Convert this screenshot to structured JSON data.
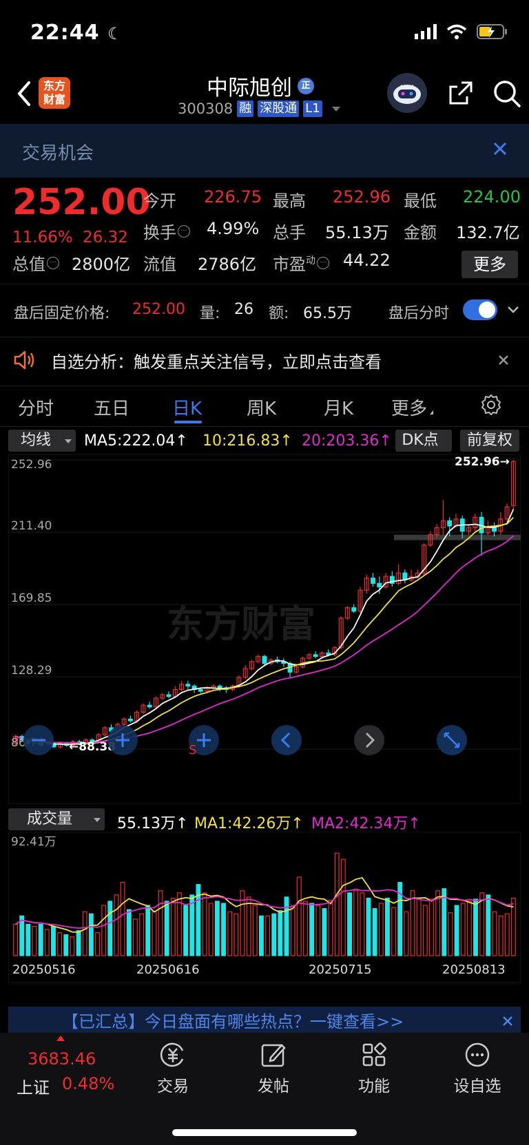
{
  "status": {
    "time": "22:44"
  },
  "nav": {
    "logo_line1": "东方",
    "logo_line2": "财富",
    "stock_name": "中际旭创",
    "name_badge": "正",
    "code": "300308",
    "tags": [
      "融",
      "深股通",
      "L1"
    ]
  },
  "opportunity": {
    "text": "交易机会"
  },
  "quote": {
    "price": "252.00",
    "pct": "11.66%",
    "change": "26.32",
    "open_label": "今开",
    "open": "226.75",
    "high_label": "最高",
    "high": "252.96",
    "low_label": "最低",
    "low": "224.00",
    "turnover_label": "换手",
    "turnover": "4.99%",
    "volume_label": "总手",
    "volume": "55.13万",
    "amount_label": "金额",
    "amount": "132.7亿",
    "mcap_label": "总值",
    "mcap": "2800亿",
    "float_label": "流值",
    "float": "2786亿",
    "pe_label": "市盈",
    "pe_sup": "动",
    "pe": "44.22",
    "more_label": "更多"
  },
  "after_hours": {
    "fixed_label": "盘后固定价格:",
    "fixed_price": "252.00",
    "vol_label": "量:",
    "vol": "26",
    "amt_label": "额:",
    "amt": "65.5万",
    "timeshare_label": "盘后分时"
  },
  "notice": {
    "text": "自选分析：触发重点关注信号，立即点击查看"
  },
  "tabs": [
    {
      "label": "分时"
    },
    {
      "label": "五日"
    },
    {
      "label": "日K"
    },
    {
      "label": "周K"
    },
    {
      "label": "月K"
    },
    {
      "label": "更多"
    }
  ],
  "active_tab": "日K",
  "ma_row": {
    "selector": "均线",
    "ma5": "MA5:222.04↑",
    "ma10": "10:216.83↑",
    "ma20": "20:203.36↑",
    "dk": "DK点",
    "adjust": "前复权"
  },
  "vol_row": {
    "selector": "成交量",
    "vol": "55.13万↑",
    "ma1": "MA1:42.26万↑",
    "ma2": "MA2:42.34万↑"
  },
  "colors": {
    "up": "#ef2c2c",
    "down": "#1ee6e6",
    "ma5": "#ffffff",
    "ma10": "#f2e33a",
    "ma20": "#e22ad0",
    "accent": "#3a7cf0"
  },
  "chart_data": [
    {
      "type": "candlestick",
      "y_ticks": [
        "252.96",
        "211.40",
        "169.85",
        "128.29",
        "86.74"
      ],
      "ylim": [
        86.74,
        252.96
      ],
      "high_label": "252.96→",
      "low_label": "←88.38",
      "watermark": "东方财富",
      "candles": [
        [
          90,
          94,
          89,
          95
        ],
        [
          94,
          92,
          91,
          95
        ],
        [
          92,
          90,
          89,
          93
        ],
        [
          90,
          91,
          89,
          92
        ],
        [
          91,
          89,
          88,
          92
        ],
        [
          89,
          90,
          88.38,
          91
        ],
        [
          90,
          88,
          87.5,
          91
        ],
        [
          88,
          90,
          87,
          91
        ],
        [
          90,
          89,
          88,
          91
        ],
        [
          89,
          91,
          88,
          92
        ],
        [
          91,
          90,
          89,
          92
        ],
        [
          90,
          92,
          89,
          93
        ],
        [
          92,
          91,
          90,
          93
        ],
        [
          91,
          95,
          90,
          96
        ],
        [
          95,
          99,
          94,
          100
        ],
        [
          99,
          97,
          96,
          101
        ],
        [
          97,
          101,
          96,
          102
        ],
        [
          101,
          104,
          100,
          105
        ],
        [
          104,
          103,
          102,
          106
        ],
        [
          103,
          108,
          102,
          109
        ],
        [
          108,
          112,
          107,
          113
        ],
        [
          112,
          111,
          110,
          114
        ],
        [
          111,
          116,
          110,
          117
        ],
        [
          116,
          118,
          115,
          119
        ],
        [
          118,
          117,
          116,
          120
        ],
        [
          117,
          121,
          116,
          123
        ],
        [
          121,
          124,
          120,
          126
        ],
        [
          124,
          123,
          121,
          126
        ],
        [
          123,
          121,
          119,
          124
        ],
        [
          121,
          120,
          119,
          122
        ],
        [
          120,
          122,
          119,
          123
        ],
        [
          122,
          123,
          121,
          124
        ],
        [
          123,
          122,
          120,
          124
        ],
        [
          122,
          121,
          119,
          123
        ],
        [
          121,
          123,
          120,
          124
        ],
        [
          123,
          128,
          122,
          129
        ],
        [
          128,
          133,
          127,
          135
        ],
        [
          133,
          137,
          132,
          138
        ],
        [
          137,
          140,
          136,
          141
        ],
        [
          140,
          136,
          135,
          141
        ],
        [
          136,
          138,
          135,
          139
        ],
        [
          138,
          137,
          136,
          140
        ],
        [
          137,
          136,
          134,
          139
        ],
        [
          136,
          131,
          128,
          137
        ],
        [
          131,
          134,
          130,
          135
        ],
        [
          134,
          139,
          133,
          140
        ],
        [
          139,
          141,
          138,
          142
        ],
        [
          141,
          140,
          139,
          143
        ],
        [
          140,
          142,
          139,
          143
        ],
        [
          142,
          141,
          140,
          144
        ],
        [
          141,
          145,
          140,
          146
        ],
        [
          145,
          162,
          144,
          163
        ],
        [
          162,
          168,
          161,
          169
        ],
        [
          168,
          166,
          165,
          170
        ],
        [
          166,
          178,
          165,
          180
        ],
        [
          178,
          185,
          176,
          187
        ],
        [
          185,
          182,
          180,
          188
        ],
        [
          182,
          180,
          176,
          186
        ],
        [
          180,
          186,
          179,
          188
        ],
        [
          186,
          182,
          180,
          189
        ],
        [
          182,
          188,
          181,
          193
        ],
        [
          188,
          184,
          182,
          190
        ],
        [
          184,
          186,
          183,
          190
        ],
        [
          186,
          188,
          185,
          190
        ],
        [
          188,
          204,
          187,
          205
        ],
        [
          204,
          210,
          203,
          212
        ],
        [
          210,
          214,
          208,
          216
        ],
        [
          214,
          218,
          210,
          230
        ],
        [
          218,
          215,
          209,
          220
        ],
        [
          215,
          219,
          214,
          222
        ],
        [
          219,
          212,
          208,
          221
        ],
        [
          212,
          214,
          210,
          216
        ],
        [
          214,
          220,
          212,
          222
        ],
        [
          220,
          211,
          198,
          223
        ],
        [
          211,
          214,
          210,
          218
        ],
        [
          214,
          212,
          209,
          217
        ],
        [
          212,
          219,
          210,
          223
        ],
        [
          219,
          226,
          217,
          228
        ],
        [
          226.75,
          252,
          224,
          252.96
        ]
      ]
    },
    {
      "type": "bar",
      "title": "成交量",
      "y_max_label": "92.41万",
      "x_labels": [
        "20250516",
        "20250616",
        "20250715",
        "20250813"
      ],
      "values": [
        30,
        38,
        30,
        28,
        30,
        25,
        28,
        22,
        20,
        18,
        24,
        42,
        40,
        22,
        48,
        52,
        58,
        70,
        44,
        35,
        40,
        48,
        42,
        62,
        52,
        55,
        60,
        48,
        58,
        68,
        60,
        50,
        52,
        50,
        42,
        40,
        62,
        56,
        48,
        38,
        38,
        40,
        43,
        56,
        48,
        75,
        52,
        50,
        48,
        45,
        53,
        98,
        92,
        60,
        62,
        60,
        55,
        45,
        50,
        55,
        46,
        70,
        42,
        62,
        55,
        48,
        54,
        62,
        64,
        41,
        48,
        50,
        52,
        54,
        60,
        58,
        42,
        38,
        40,
        55
      ]
    }
  ]
}
